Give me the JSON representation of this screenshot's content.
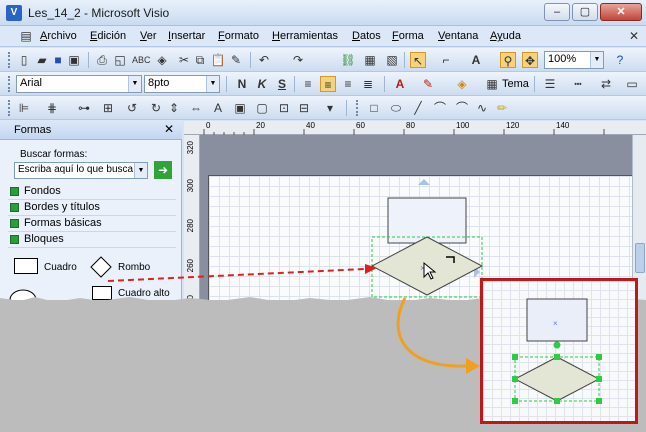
{
  "window": {
    "title": "Les_14_2 - Microsoft Visio"
  },
  "menu": [
    {
      "key": "A",
      "rest": "rchivo"
    },
    {
      "key": "E",
      "rest": "dición"
    },
    {
      "key": "V",
      "rest": "er"
    },
    {
      "key": "I",
      "rest": "nsertar"
    },
    {
      "key": "F",
      "rest": "ormato"
    },
    {
      "key": "H",
      "rest": "erramientas"
    },
    {
      "key": "D",
      "rest": "atos"
    },
    {
      "key": "F",
      "rest": "orma"
    },
    {
      "key": "V",
      "rest": "entana"
    },
    {
      "key": "Ay",
      "rest": "uda"
    }
  ],
  "toolbar": {
    "zoom": "100%",
    "font": "Arial",
    "size": "8pto",
    "bold": "N",
    "italic": "K",
    "underline": "S",
    "theme": "Tema"
  },
  "shapes_panel": {
    "title": "Formas",
    "search_label": "Buscar formas:",
    "search_placeholder": "Escriba aquí lo que busca",
    "stencils": [
      "Fondos",
      "Bordes y títulos",
      "Formas básicas",
      "Bloques"
    ],
    "shapes": [
      "Cuadro",
      "Rombo",
      "Cuadro alto"
    ]
  },
  "ruler": {
    "h_labels": [
      "0",
      "20",
      "40",
      "60",
      "80",
      "100",
      "120",
      "140"
    ],
    "v_labels": [
      "320",
      "300",
      "280",
      "260",
      "240"
    ]
  },
  "colors": {
    "accent": "#c01818",
    "arrow": "#f0a020",
    "dashed_arrow": "#e02020",
    "selection": "#2ecc40",
    "shape_fill": "#e9eef8",
    "diamond_fill": "#e3e6d4"
  }
}
